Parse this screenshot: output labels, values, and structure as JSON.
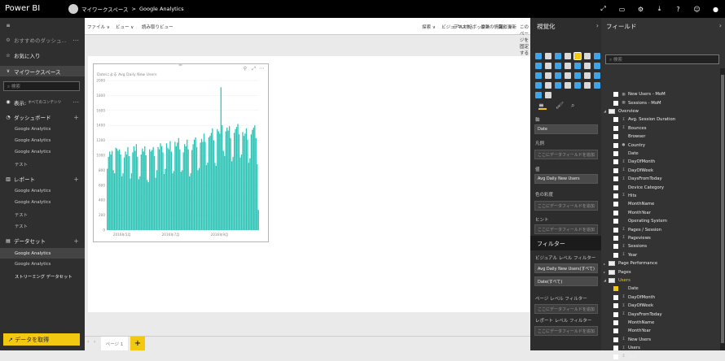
{
  "app": {
    "name": "Power BI"
  },
  "breadcrumb": {
    "workspace": "マイワークスペース",
    "separator": ">",
    "item": "Google Analytics"
  },
  "sidebar": {
    "recommended": "おすすめのダッシュ...",
    "favorites": "お気に入り",
    "workspace": "マイワークスペース",
    "search_placeholder": "検索",
    "display_label": "表示:",
    "display_value": "すべてのコンテンツ",
    "dashboards_header": "ダッシュボード",
    "dashboards": [
      "Google Analytics",
      "Google Analytics",
      "Google Analytics",
      "テスト"
    ],
    "reports_header": "レポート",
    "reports": [
      "Google Analytics",
      "Google Analytics",
      "テスト",
      "テスト"
    ],
    "datasets_header": "データセット",
    "datasets": [
      "Google Analytics",
      "Google Analytics",
      "ストリーミング データセット"
    ],
    "get_data": "データを取得"
  },
  "ribbon": {
    "file": "ファイル ∨",
    "view": "ビュー ∨",
    "reading_view": "読み取りビュー",
    "explore": "探索 ∨",
    "textbox": "テキスト ボックス",
    "shapes": "図形 ∨",
    "visual_interactions": "ビジュアル対話",
    "refresh": "最新の情報に更新",
    "pin_page": "このページを固定する",
    "save": "保存"
  },
  "visual": {
    "title": "Dateによる Avg Daily New Users"
  },
  "pages": {
    "tab1": "ページ 1",
    "add": "+"
  },
  "viz_pane": {
    "title": "視覚化",
    "axis_label": "軸",
    "axis_value": "Date",
    "legend_label": "凡例",
    "legend_placeholder": "ここにデータフィールドを追加",
    "value_label": "値",
    "value_value": "Avg Daily New Users",
    "color_label": "色の彩度",
    "color_placeholder": "ここにデータフィールドを追加",
    "tooltip_label": "ヒント",
    "tooltip_placeholder": "ここにデータフィールドを追加",
    "filters_title": "フィルター",
    "visual_filters_label": "ビジュアル レベル フィルター",
    "visual_filter_1": "Avg Daily New Users(すべて)",
    "visual_filter_2": "Date(すべて)",
    "page_filters_label": "ページ レベル フィルター",
    "page_filters_placeholder": "ここにデータフィールドを追加",
    "report_filters_label": "レポート レベル フィルター",
    "report_filters_placeholder": "ここにデータフィールドを追加"
  },
  "fields_pane": {
    "title": "フィールド",
    "search_placeholder": "検索",
    "items": [
      {
        "label": "New Users - MoM",
        "level": 1,
        "kind": "measure"
      },
      {
        "label": "Sessions - MoM",
        "level": 1,
        "kind": "measure"
      },
      {
        "label": "Overview",
        "level": 0,
        "kind": "table"
      },
      {
        "label": "Avg. Session Duration",
        "level": 1,
        "kind": "sigma"
      },
      {
        "label": "Bounces",
        "level": 1,
        "kind": "sigma"
      },
      {
        "label": "Browser",
        "level": 1,
        "kind": "text"
      },
      {
        "label": "Country",
        "level": 1,
        "kind": "geo"
      },
      {
        "label": "Date",
        "level": 1,
        "kind": "text"
      },
      {
        "label": "DayOfMonth",
        "level": 1,
        "kind": "sigma"
      },
      {
        "label": "DayOfWeek",
        "level": 1,
        "kind": "sigma"
      },
      {
        "label": "DaysFromToday",
        "level": 1,
        "kind": "sigma"
      },
      {
        "label": "Device Category",
        "level": 1,
        "kind": "text"
      },
      {
        "label": "Hits",
        "level": 1,
        "kind": "sigma"
      },
      {
        "label": "MonthName",
        "level": 1,
        "kind": "text"
      },
      {
        "label": "MonthYear",
        "level": 1,
        "kind": "text"
      },
      {
        "label": "Operating System",
        "level": 1,
        "kind": "text"
      },
      {
        "label": "Pages / Session",
        "level": 1,
        "kind": "sigma"
      },
      {
        "label": "Pageviews",
        "level": 1,
        "kind": "sigma"
      },
      {
        "label": "Sessions",
        "level": 1,
        "kind": "sigma"
      },
      {
        "label": "Year",
        "level": 1,
        "kind": "sigma"
      },
      {
        "label": "Page Performance",
        "level": 0,
        "kind": "table",
        "collapsed": true
      },
      {
        "label": "Pages",
        "level": 0,
        "kind": "table",
        "collapsed": true
      },
      {
        "label": "Users",
        "level": 0,
        "kind": "table",
        "active": true
      },
      {
        "label": "Date",
        "level": 1,
        "kind": "text",
        "checked": true
      },
      {
        "label": "DayOfMonth",
        "level": 1,
        "kind": "sigma"
      },
      {
        "label": "DayOfWeek",
        "level": 1,
        "kind": "sigma"
      },
      {
        "label": "DaysFromToday",
        "level": 1,
        "kind": "sigma"
      },
      {
        "label": "MonthName",
        "level": 1,
        "kind": "text"
      },
      {
        "label": "MonthYear",
        "level": 1,
        "kind": "text"
      },
      {
        "label": "New Users",
        "level": 1,
        "kind": "sigma"
      },
      {
        "label": "Users",
        "level": 1,
        "kind": "sigma"
      },
      {
        "label": "Year",
        "level": 1,
        "kind": "sigma"
      }
    ]
  },
  "colors": {
    "accent": "#f2c811",
    "bar": "#2ec4b6",
    "topbar": "#000000",
    "sidebar": "#2f2f2f"
  },
  "chart_data": {
    "type": "bar",
    "title": "Dateによる Avg Daily New Users",
    "ylim": [
      0,
      2000
    ],
    "y_ticks": [
      0,
      200,
      400,
      600,
      800,
      1000,
      1200,
      1400,
      1600,
      1800,
      2000
    ],
    "x_tick_labels": [
      "2016年5月",
      "2016年7月",
      "2016年9月"
    ],
    "x_tick_positions": [
      0.1,
      0.42,
      0.74
    ],
    "note_values": "approximate daily averages, one bar per day",
    "values": [
      820,
      980,
      1050,
      1010,
      1060,
      800,
      760,
      1100,
      1090,
      1060,
      1080,
      1010,
      720,
      760,
      970,
      1050,
      1010,
      1110,
      990,
      690,
      760,
      1040,
      1120,
      1060,
      1150,
      980,
      680,
      720,
      1010,
      1090,
      1050,
      1120,
      1000,
      670,
      640,
      1080,
      1050,
      1070,
      1110,
      990,
      700,
      800,
      1110,
      1080,
      1160,
      1120,
      1040,
      750,
      820,
      1160,
      1100,
      1080,
      1190,
      1050,
      760,
      790,
      1180,
      1120,
      1170,
      1230,
      1080,
      780,
      800,
      1040,
      1150,
      1120,
      1210,
      1080,
      720,
      760,
      1070,
      1150,
      1210,
      1240,
      1110,
      800,
      830,
      1170,
      1220,
      1180,
      1290,
      1180,
      870,
      900,
      1240,
      1260,
      1300,
      1360,
      1200,
      900,
      860,
      1350,
      1320,
      1290,
      1910,
      1400,
      1060,
      990,
      1320,
      1370,
      1330,
      1390,
      1230,
      920,
      980,
      1300,
      1350,
      1380,
      1420,
      1280,
      970,
      1010,
      1310,
      1260,
      1290,
      1360,
      1210,
      900,
      960,
      1280,
      1340,
      1370,
      1400,
      1230,
      880,
      270
    ]
  }
}
